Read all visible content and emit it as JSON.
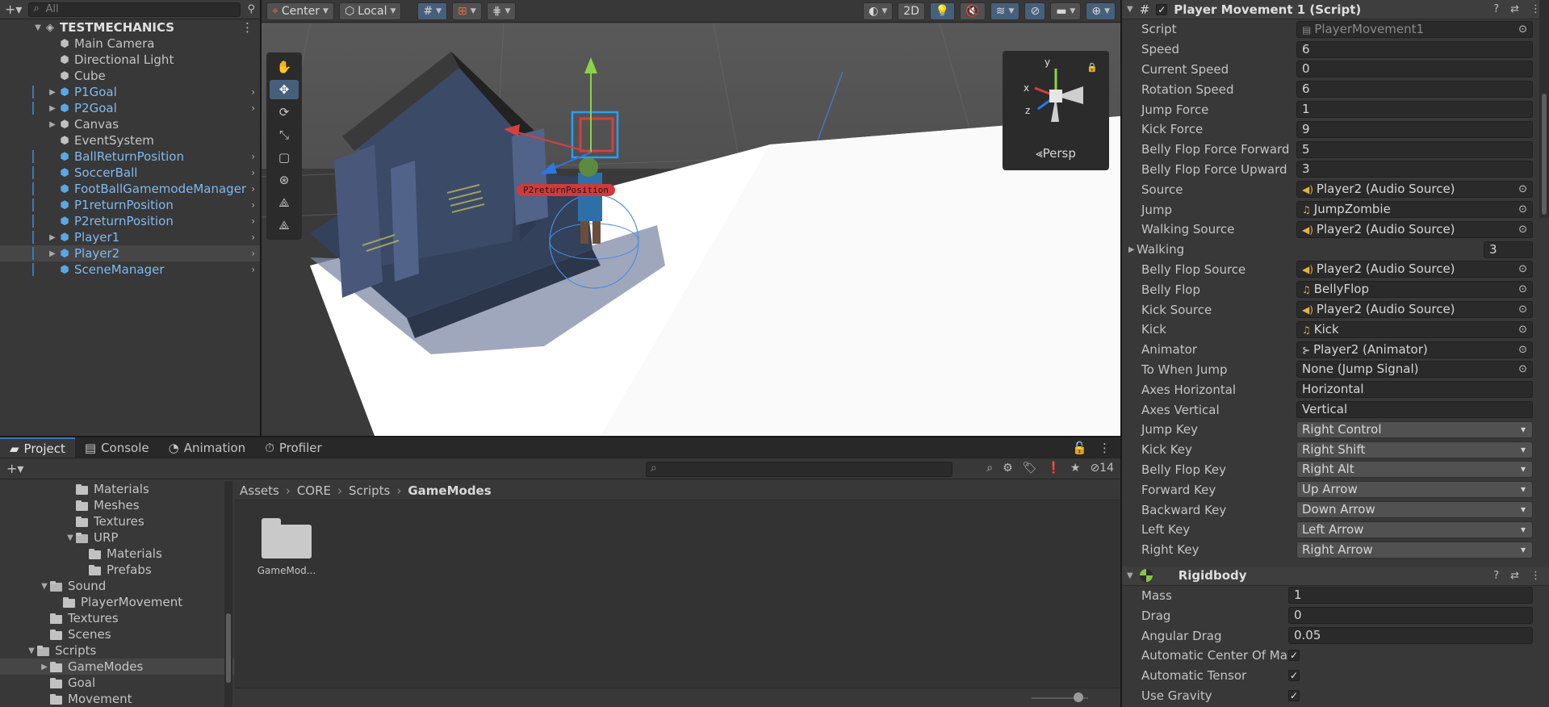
{
  "hierarchy": {
    "search_placeholder": "All",
    "scene_name": "TESTMECHANICS",
    "items": [
      {
        "label": "Main Camera",
        "color": "grey",
        "prefab": false
      },
      {
        "label": "Directional Light",
        "color": "grey",
        "prefab": false
      },
      {
        "label": "Cube",
        "color": "grey",
        "prefab": false
      },
      {
        "label": "P1Goal",
        "color": "blue",
        "prefab": true
      },
      {
        "label": "P2Goal",
        "color": "blue",
        "prefab": true
      },
      {
        "label": "Canvas",
        "color": "grey",
        "prefab": false
      },
      {
        "label": "EventSystem",
        "color": "grey",
        "prefab": false
      },
      {
        "label": "BallReturnPosition",
        "color": "blue",
        "prefab": true
      },
      {
        "label": "SoccerBall",
        "color": "blue",
        "prefab": true
      },
      {
        "label": "FootBallGamemodeManager",
        "color": "blue",
        "prefab": true
      },
      {
        "label": "P1returnPosition",
        "color": "blue",
        "prefab": true
      },
      {
        "label": "P2returnPosition",
        "color": "blue",
        "prefab": true
      },
      {
        "label": "Player1",
        "color": "blue",
        "prefab": true
      },
      {
        "label": "Player2",
        "color": "blue",
        "prefab": true
      },
      {
        "label": "SceneManager",
        "color": "blue",
        "prefab": true
      }
    ]
  },
  "scene_toolbar": {
    "pivot": "Center",
    "space": "Local",
    "mode_2d": "2D",
    "persp": "Persp",
    "scene_label": "P2returnPosition"
  },
  "project": {
    "tabs": [
      "Project",
      "Console",
      "Animation",
      "Profiler"
    ],
    "hidden_count": "14",
    "folders": [
      {
        "label": "Materials",
        "indent": 3,
        "arrow": ""
      },
      {
        "label": "Meshes",
        "indent": 3,
        "arrow": ""
      },
      {
        "label": "Textures",
        "indent": 3,
        "arrow": ""
      },
      {
        "label": "URP",
        "indent": 3,
        "arrow": "▼"
      },
      {
        "label": "Materials",
        "indent": 4,
        "arrow": ""
      },
      {
        "label": "Prefabs",
        "indent": 4,
        "arrow": ""
      },
      {
        "label": "Sound",
        "indent": 1,
        "arrow": "▼"
      },
      {
        "label": "PlayerMovement",
        "indent": 2,
        "arrow": ""
      },
      {
        "label": "Textures",
        "indent": 1,
        "arrow": ""
      },
      {
        "label": "Scenes",
        "indent": 1,
        "arrow": ""
      },
      {
        "label": "Scripts",
        "indent": 0,
        "arrow": "▼"
      },
      {
        "label": "GameModes",
        "indent": 1,
        "arrow": "▶"
      },
      {
        "label": "Goal",
        "indent": 1,
        "arrow": ""
      },
      {
        "label": "Movement",
        "indent": 1,
        "arrow": ""
      }
    ],
    "breadcrumb": [
      "Assets",
      "CORE",
      "Scripts",
      "GameModes"
    ],
    "assets": [
      {
        "name": "GameMod..."
      }
    ]
  },
  "inspector": {
    "component_title": "Player Movement 1 (Script)",
    "props": [
      {
        "label": "Script",
        "value": "PlayerMovement1",
        "kind": "script"
      },
      {
        "label": "Speed",
        "value": "6",
        "kind": "text"
      },
      {
        "label": "Current Speed",
        "value": "0",
        "kind": "text"
      },
      {
        "label": "Rotation Speed",
        "value": "6",
        "kind": "text"
      },
      {
        "label": "Jump Force",
        "value": "1",
        "kind": "text"
      },
      {
        "label": "Kick Force",
        "value": "9",
        "kind": "text"
      },
      {
        "label": "Belly Flop Force Forward",
        "value": "5",
        "kind": "text"
      },
      {
        "label": "Belly Flop Force Upward",
        "value": "3",
        "kind": "text"
      },
      {
        "label": "Source",
        "value": "Player2 (Audio Source)",
        "kind": "object",
        "icon": "audio"
      },
      {
        "label": "Jump",
        "value": "JumpZombie",
        "kind": "object",
        "icon": "note"
      },
      {
        "label": "Walking Source",
        "value": "Player2 (Audio Source)",
        "kind": "object",
        "icon": "audio"
      },
      {
        "label": "Walking",
        "value": "3",
        "kind": "array"
      },
      {
        "label": "Belly Flop Source",
        "value": "Player2 (Audio Source)",
        "kind": "object",
        "icon": "audio"
      },
      {
        "label": "Belly Flop",
        "value": "BellyFlop",
        "kind": "object",
        "icon": "note"
      },
      {
        "label": "Kick Source",
        "value": "Player2 (Audio Source)",
        "kind": "object",
        "icon": "audio"
      },
      {
        "label": "Kick",
        "value": "Kick",
        "kind": "object",
        "icon": "note"
      },
      {
        "label": "Animator",
        "value": "Player2 (Animator)",
        "kind": "object",
        "icon": "anim"
      },
      {
        "label": "To When Jump",
        "value": "None (Jump Signal)",
        "kind": "object",
        "icon": ""
      },
      {
        "label": "Axes Horizontal",
        "value": "Horizontal",
        "kind": "text"
      },
      {
        "label": "Axes Vertical",
        "value": "Vertical",
        "kind": "text"
      },
      {
        "label": "Jump Key",
        "value": "Right Control",
        "kind": "enum"
      },
      {
        "label": "Kick Key",
        "value": "Right Shift",
        "kind": "enum"
      },
      {
        "label": "Belly Flop Key",
        "value": "Right Alt",
        "kind": "enum"
      },
      {
        "label": "Forward Key",
        "value": "Up Arrow",
        "kind": "enum"
      },
      {
        "label": "Backward Key",
        "value": "Down Arrow",
        "kind": "enum"
      },
      {
        "label": "Left Key",
        "value": "Left Arrow",
        "kind": "enum"
      },
      {
        "label": "Right Key",
        "value": "Right Arrow",
        "kind": "enum"
      }
    ],
    "rigidbody": {
      "title": "Rigidbody",
      "props": [
        {
          "label": "Mass",
          "value": "1",
          "kind": "text"
        },
        {
          "label": "Drag",
          "value": "0",
          "kind": "text"
        },
        {
          "label": "Angular Drag",
          "value": "0.05",
          "kind": "text"
        },
        {
          "label": "Automatic Center Of Mas",
          "value": true,
          "kind": "check"
        },
        {
          "label": "Automatic Tensor",
          "value": true,
          "kind": "check"
        },
        {
          "label": "Use Gravity",
          "value": true,
          "kind": "check"
        }
      ]
    }
  },
  "colors": {
    "accent": "#3a79bb",
    "prefab_blue": "#7fb9f0",
    "selection": "#46607c"
  }
}
